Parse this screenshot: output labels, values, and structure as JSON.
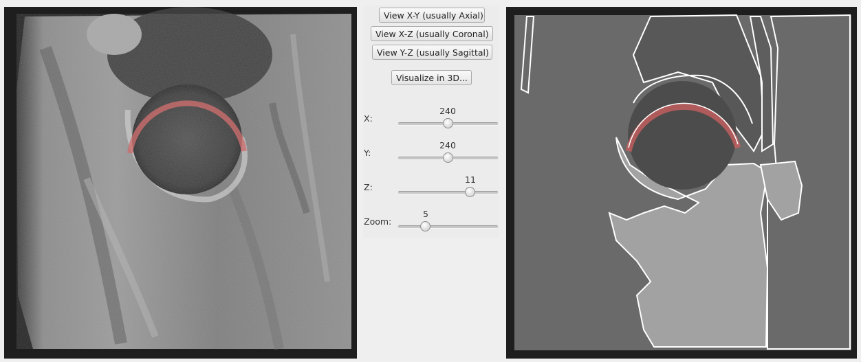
{
  "buttons": {
    "view_xy": "View X-Y (usually Axial)",
    "view_xz": "View X-Z (usually Coronal)",
    "view_yz": "View Y-Z (usually Sagittal)",
    "visualize_3d": "Visualize in 3D..."
  },
  "sliders": {
    "x": {
      "label": "X:",
      "value": "240",
      "fraction": 0.5
    },
    "y": {
      "label": "Y:",
      "value": "240",
      "fraction": 0.5
    },
    "z": {
      "label": "Z:",
      "value": "11",
      "fraction": 0.74
    },
    "zoom": {
      "label": "Zoom:",
      "value": "5",
      "fraction": 0.27
    }
  },
  "images": {
    "left": "mri-scan",
    "right": "segmentation-map"
  },
  "colors": {
    "overlay": "#d06060",
    "background": "#efefef",
    "segment_outline": "#ffffff"
  }
}
